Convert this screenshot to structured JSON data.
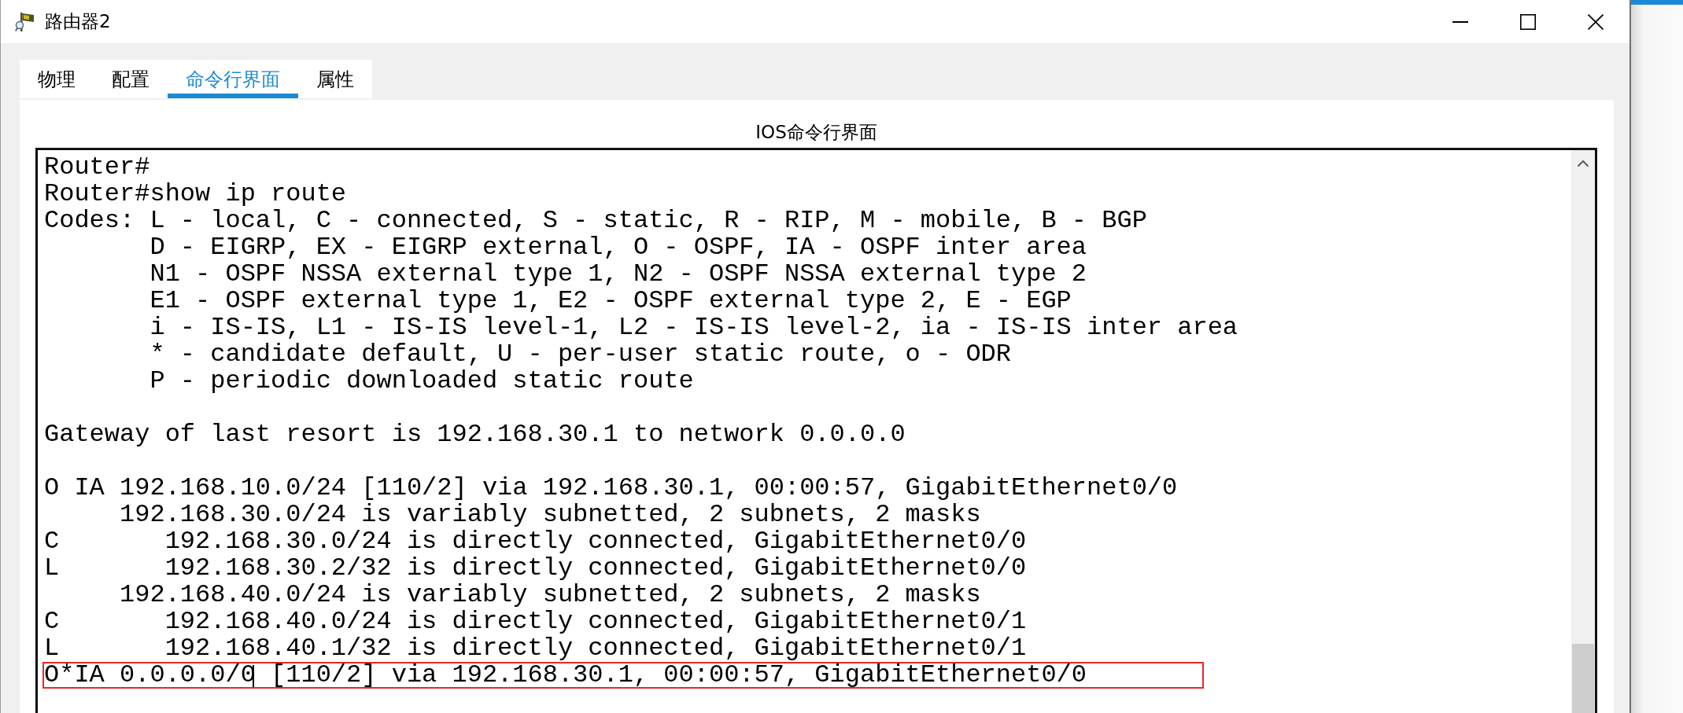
{
  "window": {
    "title": "路由器2"
  },
  "tabs": [
    {
      "label": "物理",
      "selected": false
    },
    {
      "label": "配置",
      "selected": false
    },
    {
      "label": "命令行界面",
      "selected": true
    },
    {
      "label": "属性",
      "selected": false
    }
  ],
  "panel": {
    "title": "IOS命令行界面"
  },
  "terminal": {
    "blocks": [
      {
        "lines": [
          {
            "text": "Router#",
            "highlighted": false,
            "cursor": false
          },
          {
            "text": "Router#show ip route",
            "highlighted": false,
            "cursor": false
          },
          {
            "text": "Codes: L - local, C - connected, S - static, R - RIP, M - mobile, B - BGP",
            "highlighted": false,
            "cursor": false
          },
          {
            "text": "       D - EIGRP, EX - EIGRP external, O - OSPF, IA - OSPF inter area",
            "highlighted": false,
            "cursor": false
          },
          {
            "text": "       N1 - OSPF NSSA external type 1, N2 - OSPF NSSA external type 2",
            "highlighted": false,
            "cursor": false
          },
          {
            "text": "       E1 - OSPF external type 1, E2 - OSPF external type 2, E - EGP",
            "highlighted": false,
            "cursor": false
          },
          {
            "text": "       i - IS-IS, L1 - IS-IS level-1, L2 - IS-IS level-2, ia - IS-IS inter area",
            "highlighted": false,
            "cursor": false
          },
          {
            "text": "       * - candidate default, U - per-user static route, o - ODR",
            "highlighted": false,
            "cursor": false
          },
          {
            "text": "       P - periodic downloaded static route",
            "highlighted": false,
            "cursor": false
          }
        ]
      },
      {
        "lines": [
          {
            "text": "Gateway of last resort is 192.168.30.1 to network 0.0.0.0",
            "highlighted": false,
            "cursor": false
          }
        ]
      },
      {
        "lines": [
          {
            "text": "O IA 192.168.10.0/24 [110/2] via 192.168.30.1, 00:00:57, GigabitEthernet0/0",
            "highlighted": false,
            "cursor": false
          },
          {
            "text": "     192.168.30.0/24 is variably subnetted, 2 subnets, 2 masks",
            "highlighted": false,
            "cursor": false
          },
          {
            "text": "C       192.168.30.0/24 is directly connected, GigabitEthernet0/0",
            "highlighted": false,
            "cursor": false
          },
          {
            "text": "L       192.168.30.2/32 is directly connected, GigabitEthernet0/0",
            "highlighted": false,
            "cursor": false
          },
          {
            "text": "     192.168.40.0/24 is variably subnetted, 2 subnets, 2 masks",
            "highlighted": false,
            "cursor": false
          },
          {
            "text": "C       192.168.40.0/24 is directly connected, GigabitEthernet0/1",
            "highlighted": false,
            "cursor": false
          },
          {
            "text": "L       192.168.40.1/32 is directly connected, GigabitEthernet0/1",
            "highlighted": false,
            "cursor": false
          },
          {
            "text": "O*IA 0.0.0.0/0 [110/2] via 192.168.30.1, 00:00:57, GigabitEthernet0/0",
            "highlighted": true,
            "cursor": true
          }
        ]
      }
    ]
  }
}
